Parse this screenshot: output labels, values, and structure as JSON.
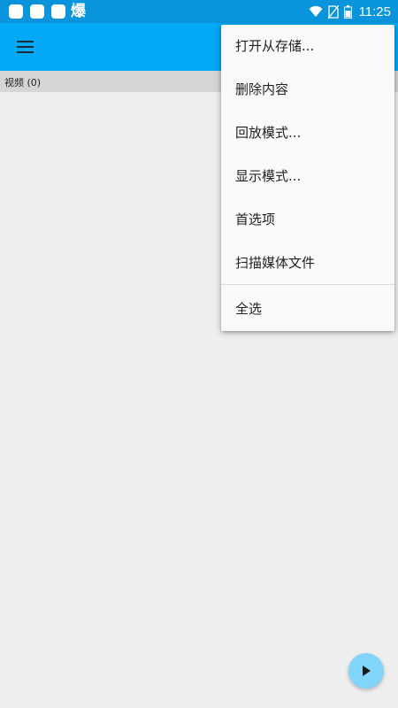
{
  "status_bar": {
    "notification_glyph": "爆",
    "time": "11:25",
    "icons": [
      "notification-square-icon",
      "wifi-icon",
      "no-sim-icon",
      "battery-icon"
    ]
  },
  "app_bar": {
    "menu_icon": "hamburger-menu-icon",
    "color": "#03a9f4"
  },
  "section": {
    "label": "视频 (0)"
  },
  "overflow_menu": {
    "items": [
      {
        "label": "打开从存储..."
      },
      {
        "label": "删除内容"
      },
      {
        "label": "回放模式..."
      },
      {
        "label": "显示模式..."
      },
      {
        "label": "首选项"
      },
      {
        "label": "扫描媒体文件"
      },
      {
        "label": "全选"
      }
    ]
  },
  "fab": {
    "icon": "play-icon",
    "color": "#81d4fa"
  },
  "colors": {
    "status_bar": "#0a94dc",
    "background": "#eeeeee",
    "section_header": "#d5d5d5"
  }
}
